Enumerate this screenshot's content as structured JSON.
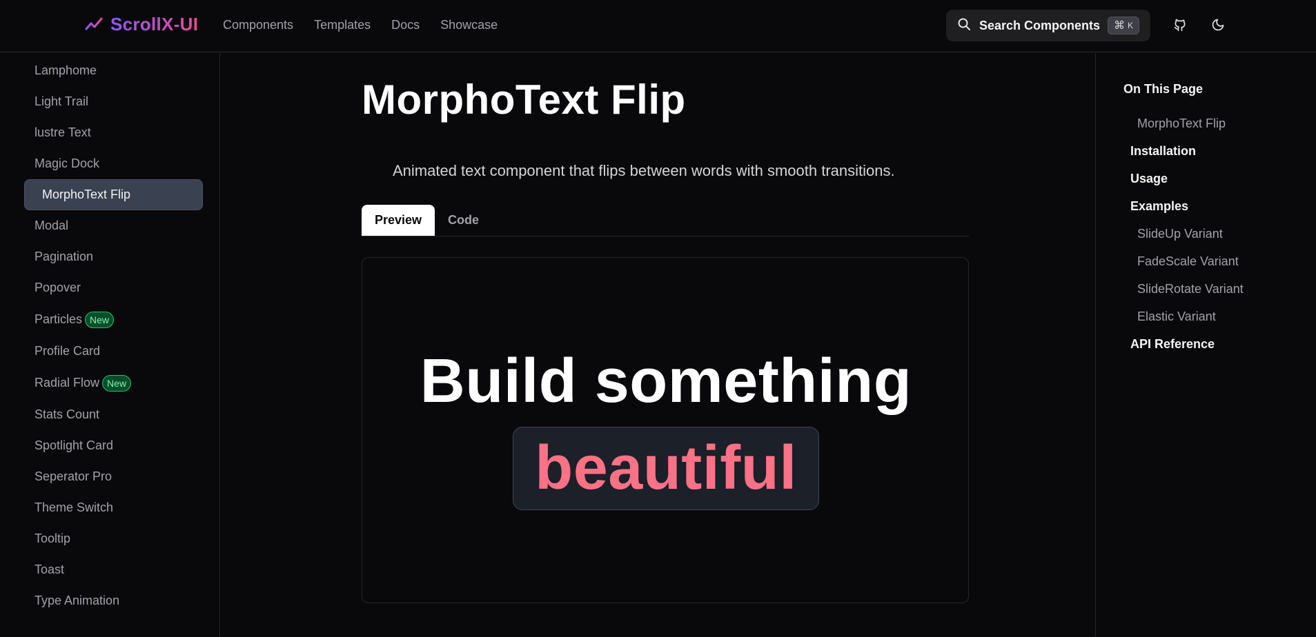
{
  "header": {
    "logo_text": "ScrollX-UI",
    "nav": [
      "Components",
      "Templates",
      "Docs",
      "Showcase"
    ],
    "search_label": "Search Components",
    "search_shortcut_cmd": "⌘",
    "search_shortcut_key": "K"
  },
  "sidebar": {
    "items": [
      {
        "label": "Lamphome",
        "badge": ""
      },
      {
        "label": "Light Trail",
        "badge": ""
      },
      {
        "label": "lustre Text",
        "badge": ""
      },
      {
        "label": "Magic Dock",
        "badge": ""
      },
      {
        "label": "MorphoText Flip",
        "badge": "",
        "active": true
      },
      {
        "label": "Modal",
        "badge": ""
      },
      {
        "label": "Pagination",
        "badge": ""
      },
      {
        "label": "Popover",
        "badge": ""
      },
      {
        "label": "Particles",
        "badge": "New"
      },
      {
        "label": "Profile Card",
        "badge": ""
      },
      {
        "label": "Radial Flow",
        "badge": "New"
      },
      {
        "label": "Stats Count",
        "badge": ""
      },
      {
        "label": "Spotlight Card",
        "badge": ""
      },
      {
        "label": "Seperator Pro",
        "badge": ""
      },
      {
        "label": "Theme Switch",
        "badge": ""
      },
      {
        "label": "Tooltip",
        "badge": ""
      },
      {
        "label": "Toast",
        "badge": ""
      },
      {
        "label": "Type Animation",
        "badge": ""
      }
    ]
  },
  "main": {
    "title": "MorphoText Flip",
    "subtitle": "Animated text component that flips between words with smooth transitions.",
    "tabs": {
      "preview": "Preview",
      "code": "Code"
    },
    "preview": {
      "static_text": "Build something",
      "flip_word": "beautiful"
    }
  },
  "toc": {
    "title": "On This Page",
    "items": [
      {
        "label": "MorphoText Flip",
        "level": "sub"
      },
      {
        "label": "Installation",
        "level": "main"
      },
      {
        "label": "Usage",
        "level": "main"
      },
      {
        "label": "Examples",
        "level": "main"
      },
      {
        "label": "SlideUp Variant",
        "level": "sub"
      },
      {
        "label": "FadeScale Variant",
        "level": "sub"
      },
      {
        "label": "SlideRotate Variant",
        "level": "sub"
      },
      {
        "label": "Elastic Variant",
        "level": "sub"
      },
      {
        "label": "API Reference",
        "level": "main"
      }
    ]
  },
  "colors": {
    "background": "#09090b",
    "accent_pink": "#fb7185",
    "logo_gradient_start": "#8b5cf6",
    "logo_gradient_end": "#ec4899",
    "badge_green": "#22c55e"
  }
}
